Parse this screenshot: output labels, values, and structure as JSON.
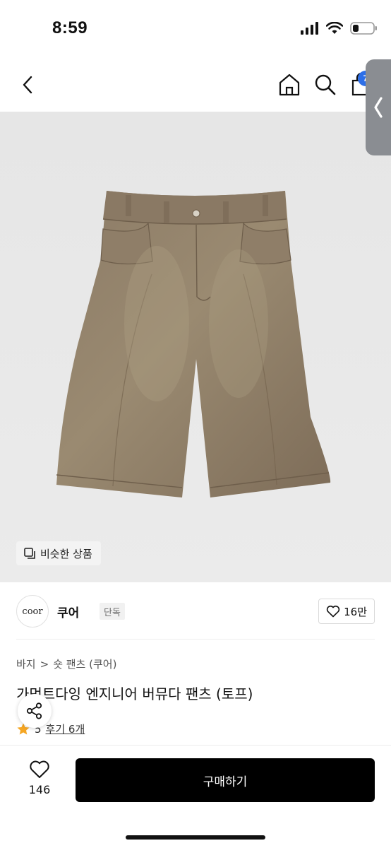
{
  "status_bar": {
    "time": "8:59"
  },
  "nav": {
    "cart_count": "7"
  },
  "similar_button": {
    "label": "비슷한 상품"
  },
  "brand": {
    "logo_text": "coor",
    "name": "쿠어",
    "tag": "단독",
    "like_count": "16만"
  },
  "breadcrumb": {
    "category": "바지",
    "separator": ">",
    "subcategory": "숏 팬츠 (쿠어)"
  },
  "product": {
    "title": "가먼트다잉 엔지니어 버뮤다 팬츠 (토프)"
  },
  "rating": {
    "score": "5",
    "reviews": "후기 6개"
  },
  "bottom": {
    "wish_count": "146",
    "buy_label": "구매하기"
  },
  "colors": {
    "accent_badge": "#2d6fe8",
    "star": "#f5a623",
    "buy_button": "#000000"
  },
  "icons": [
    "back-icon",
    "home-icon",
    "search-icon",
    "bag-icon",
    "share-icon",
    "heart-icon",
    "star-icon"
  ]
}
